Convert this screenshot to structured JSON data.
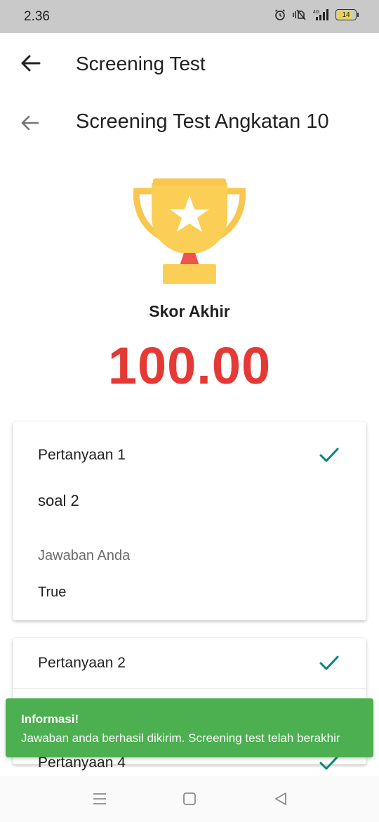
{
  "status_bar": {
    "time": "2.36",
    "battery": "14",
    "network": "4G",
    "icons": [
      "alarm-icon",
      "vibrate-off-icon",
      "signal-icon",
      "battery-icon"
    ]
  },
  "app_bar": {
    "title": "Screening Test",
    "back_icon": "arrow-left-icon"
  },
  "sub_header": {
    "title": "Screening Test Angkatan 10",
    "back_icon": "arrow-left-icon"
  },
  "result": {
    "icon": "trophy-icon",
    "label": "Skor Akhir",
    "score": "100.00"
  },
  "questions": [
    {
      "title": "Pertanyaan 1",
      "question": "soal 2",
      "answer_label": "Jawaban Anda",
      "answer": "True",
      "status": "correct"
    },
    {
      "title": "Pertanyaan 2",
      "status": "correct"
    },
    {
      "title": "Pertanyaan 4",
      "status": "correct"
    }
  ],
  "toast": {
    "title": "Informasi!",
    "message": "Jawaban anda berhasil dikirim. Screening test telah berakhir"
  },
  "nav_bar": {
    "icons": [
      "menu-icon",
      "home-icon",
      "back-icon"
    ]
  },
  "colors": {
    "score": "#e53935",
    "check": "#00897b",
    "toast": "#4caf50",
    "trophy": "#f9c74f",
    "status_bar": "#c9c9c9"
  }
}
